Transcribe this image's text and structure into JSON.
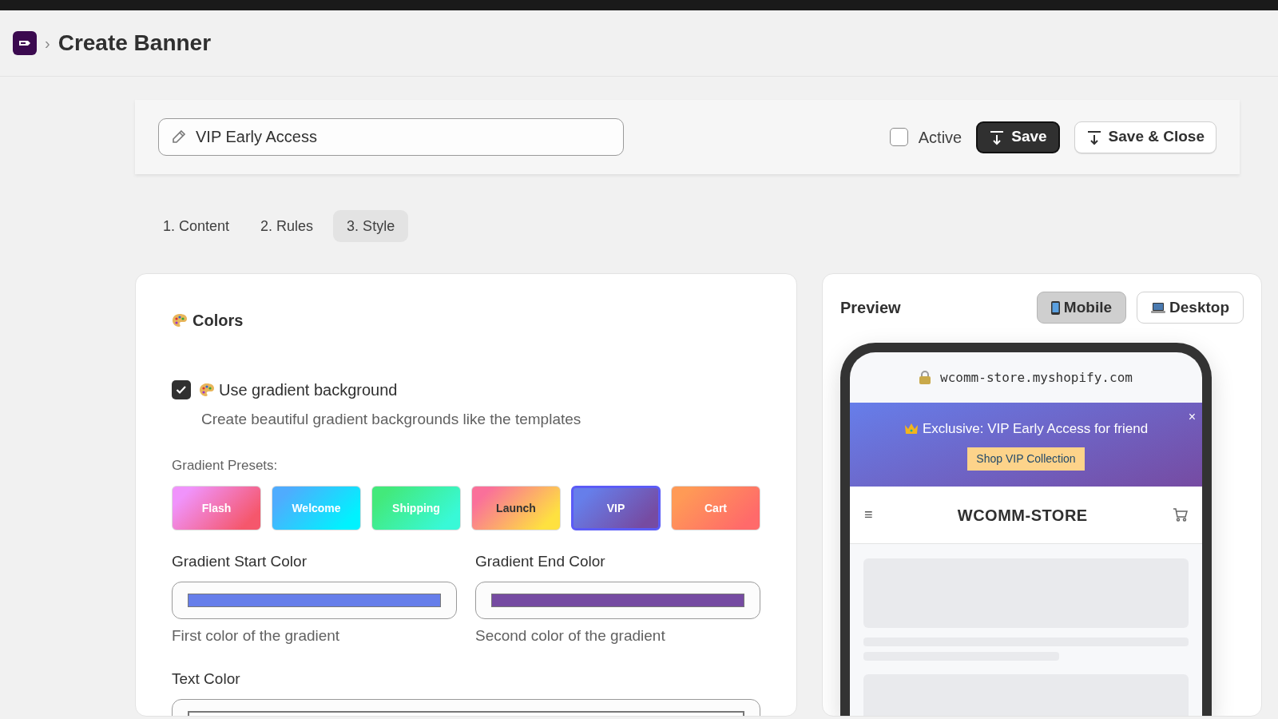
{
  "header": {
    "breadcrumb_separator": "›",
    "title": "Create Banner"
  },
  "toolbar": {
    "name_field": {
      "value": "VIP Early Access"
    },
    "active": {
      "label": "Active",
      "checked": false
    },
    "buttons": [
      "Save",
      "Save & Close"
    ]
  },
  "tabs": [
    {
      "label": "1. Content",
      "selected": false
    },
    {
      "label": "2. Rules",
      "selected": false
    },
    {
      "label": "3. Style",
      "selected": true
    }
  ],
  "colors_section": {
    "title": "Colors",
    "gradient_option": {
      "label": "Use gradient background",
      "checked": true,
      "description": "Create beautiful gradient backgrounds like the templates"
    },
    "presets_label": "Gradient Presets:",
    "presets": [
      {
        "label": "Flash",
        "stops": [
          {
            "color": "#f093fb"
          },
          {
            "color": "#f5576c"
          }
        ],
        "dark_text": false,
        "selected": false
      },
      {
        "label": "Welcome",
        "stops": [
          {
            "color": "#4facfe"
          },
          {
            "color": "#00f2fe"
          }
        ],
        "dark_text": false,
        "selected": false
      },
      {
        "label": "Shipping",
        "stops": [
          {
            "color": "#43e97b"
          },
          {
            "color": "#38f9d7"
          }
        ],
        "dark_text": false,
        "selected": false
      },
      {
        "label": "Launch",
        "stops": [
          {
            "color": "#fa709a"
          },
          {
            "color": "#fee140"
          }
        ],
        "dark_text": true,
        "selected": false
      },
      {
        "label": "VIP",
        "stops": [
          {
            "color": "#667eea"
          },
          {
            "color": "#764ba2"
          }
        ],
        "dark_text": false,
        "selected": true
      },
      {
        "label": "Cart",
        "stops": [
          {
            "color": "#ff9a56"
          },
          {
            "color": "#ff6a6a"
          }
        ],
        "dark_text": false,
        "selected": false
      }
    ],
    "start_color": {
      "label": "Gradient Start Color",
      "color": "#667eea",
      "hint": "First color of the gradient"
    },
    "end_color": {
      "label": "Gradient End Color",
      "color": "#764ba2",
      "hint": "Second color of the gradient"
    },
    "text_color": {
      "label": "Text Color",
      "color": "#ffffff"
    }
  },
  "preview": {
    "title": "Preview",
    "modes": [
      {
        "label": "Mobile",
        "selected": true
      },
      {
        "label": "Desktop",
        "selected": false
      }
    ],
    "url": "wcomm-store.myshopify.com",
    "banner": {
      "message": "Exclusive: VIP Early Access for friend",
      "button": "Shop VIP Collection",
      "close": "×"
    },
    "store": {
      "menu": "≡",
      "name": "WCOMM-STORE"
    }
  }
}
